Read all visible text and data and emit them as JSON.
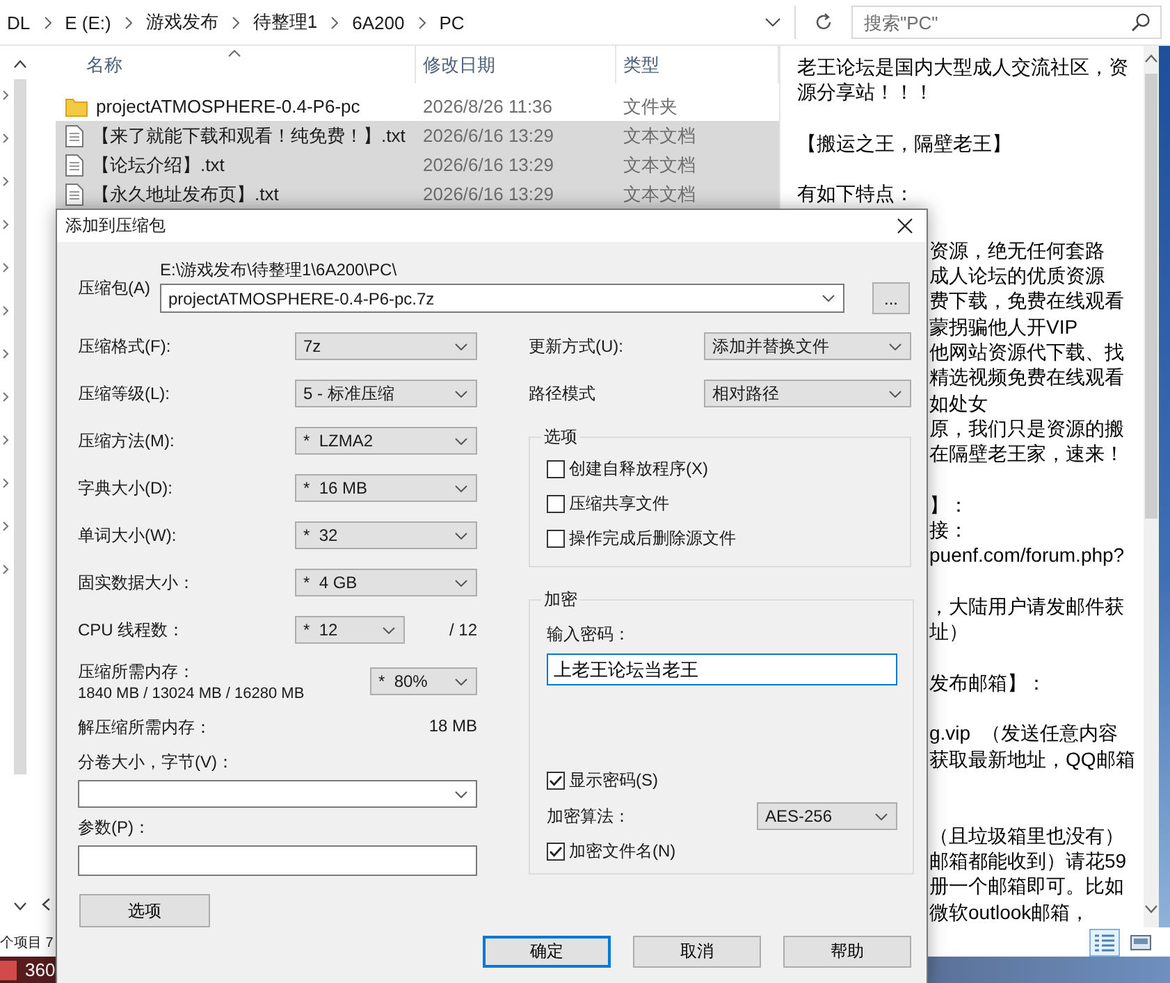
{
  "address_bar": {
    "crumbs": [
      "DL",
      "E (E:)",
      "游戏发布",
      "待整理1",
      "6A200",
      "PC"
    ]
  },
  "search": {
    "placeholder": "搜索\"PC\""
  },
  "file_list": {
    "columns": [
      "名称",
      "修改日期",
      "类型"
    ],
    "rows": [
      {
        "kind": "folder",
        "name": "projectATMOSPHERE-0.4-P6-pc",
        "date": "2026/8/26 11:36",
        "type": "文件夹",
        "selected": false
      },
      {
        "kind": "text",
        "name": "【来了就能下载和观看！纯免费！】.txt",
        "date": "2026/6/16 13:29",
        "type": "文本文档",
        "selected": true
      },
      {
        "kind": "text",
        "name": "【论坛介绍】.txt",
        "date": "2026/6/16 13:29",
        "type": "文本文档",
        "selected": true
      },
      {
        "kind": "text",
        "name": "【永久地址发布页】.txt",
        "date": "2026/6/16 13:29",
        "type": "文本文档",
        "selected": true
      }
    ]
  },
  "preview": {
    "paragraphs": [
      [
        "老王论坛是国内大型成人交流社区，资",
        "源分享站！！！"
      ],
      [
        "【搬运之王，隔壁老王】"
      ],
      [
        "有如下特点："
      ]
    ],
    "partly_covered_paragraphs": [
      [
        "资源，绝无任何套路",
        "成人论坛的优质资源",
        "费下载，免费在线观看",
        "蒙拐骗他人开VIP",
        "他网站资源代下载、找",
        "精选视频免费在线观看",
        "如处女",
        "原，我们只是资源的搬",
        "在隔壁老王家，速来！"
      ],
      [
        "】：",
        "接：",
        "puenf.com/forum.php?"
      ],
      [
        "，大陆用户请发邮件获",
        "址）"
      ],
      [
        "发布邮箱】："
      ],
      [
        "g.vip  （发送任意内容",
        "获取最新地址，QQ邮箱"
      ],
      [
        "（且垃圾箱里也没有）",
        "邮箱都能收到）请花59",
        "册一个邮箱即可。比如",
        "微软outlook邮箱，"
      ]
    ]
  },
  "status_bar": {
    "item_count": "个项目 7"
  },
  "taskbar": {
    "label": "360"
  },
  "dialog": {
    "title": "添加到压缩包",
    "archive": {
      "label": "压缩包(A)",
      "folder": "E:\\游戏发布\\待整理1\\6A200\\PC\\",
      "value": "projectATMOSPHERE-0.4-P6-pc.7z",
      "browse": "..."
    },
    "settings": [
      {
        "label": "压缩格式(F):",
        "value": "7z"
      },
      {
        "label": "压缩等级(L):",
        "value": "5 - 标准压缩"
      },
      {
        "label": "压缩方法(M):",
        "value": "*  LZMA2"
      },
      {
        "label": "字典大小(D):",
        "value": "*  16 MB"
      },
      {
        "label": "单词大小(W):",
        "value": "*  32"
      },
      {
        "label": "固实数据大小：",
        "value": "*  4 GB"
      },
      {
        "label": "CPU 线程数：",
        "value": "*  12",
        "suffix": "/ 12"
      }
    ],
    "memory": {
      "label": "压缩所需内存：",
      "detail": "1840 MB / 13024 MB / 16280 MB",
      "value": "*  80%"
    },
    "decompress_memory": {
      "label": "解压缩所需内存：",
      "value": "18 MB"
    },
    "split": {
      "label": "分卷大小，字节(V)："
    },
    "params": {
      "label": "参数(P)："
    },
    "options_button": "选项",
    "update_mode": {
      "label": "更新方式(U):",
      "value": "添加并替换文件"
    },
    "path_mode": {
      "label": "路径模式",
      "value": "相对路径"
    },
    "options_group": {
      "title": "选项",
      "checkboxes": [
        {
          "label": "创建自释放程序(X)",
          "checked": false
        },
        {
          "label": "压缩共享文件",
          "checked": false
        },
        {
          "label": "操作完成后删除源文件",
          "checked": false
        }
      ]
    },
    "encryption": {
      "title": "加密",
      "password_label": "输入密码：",
      "password": "上老王论坛当老王",
      "show_password": {
        "label": "显示密码(S)",
        "checked": true
      },
      "method_label": "加密算法：",
      "method": "AES-256",
      "encrypt_names": {
        "label": "加密文件名(N)",
        "checked": true
      }
    },
    "buttons": [
      {
        "label": "确定",
        "default": true
      },
      {
        "label": "取消",
        "default": false
      },
      {
        "label": "帮助",
        "default": false
      }
    ]
  }
}
